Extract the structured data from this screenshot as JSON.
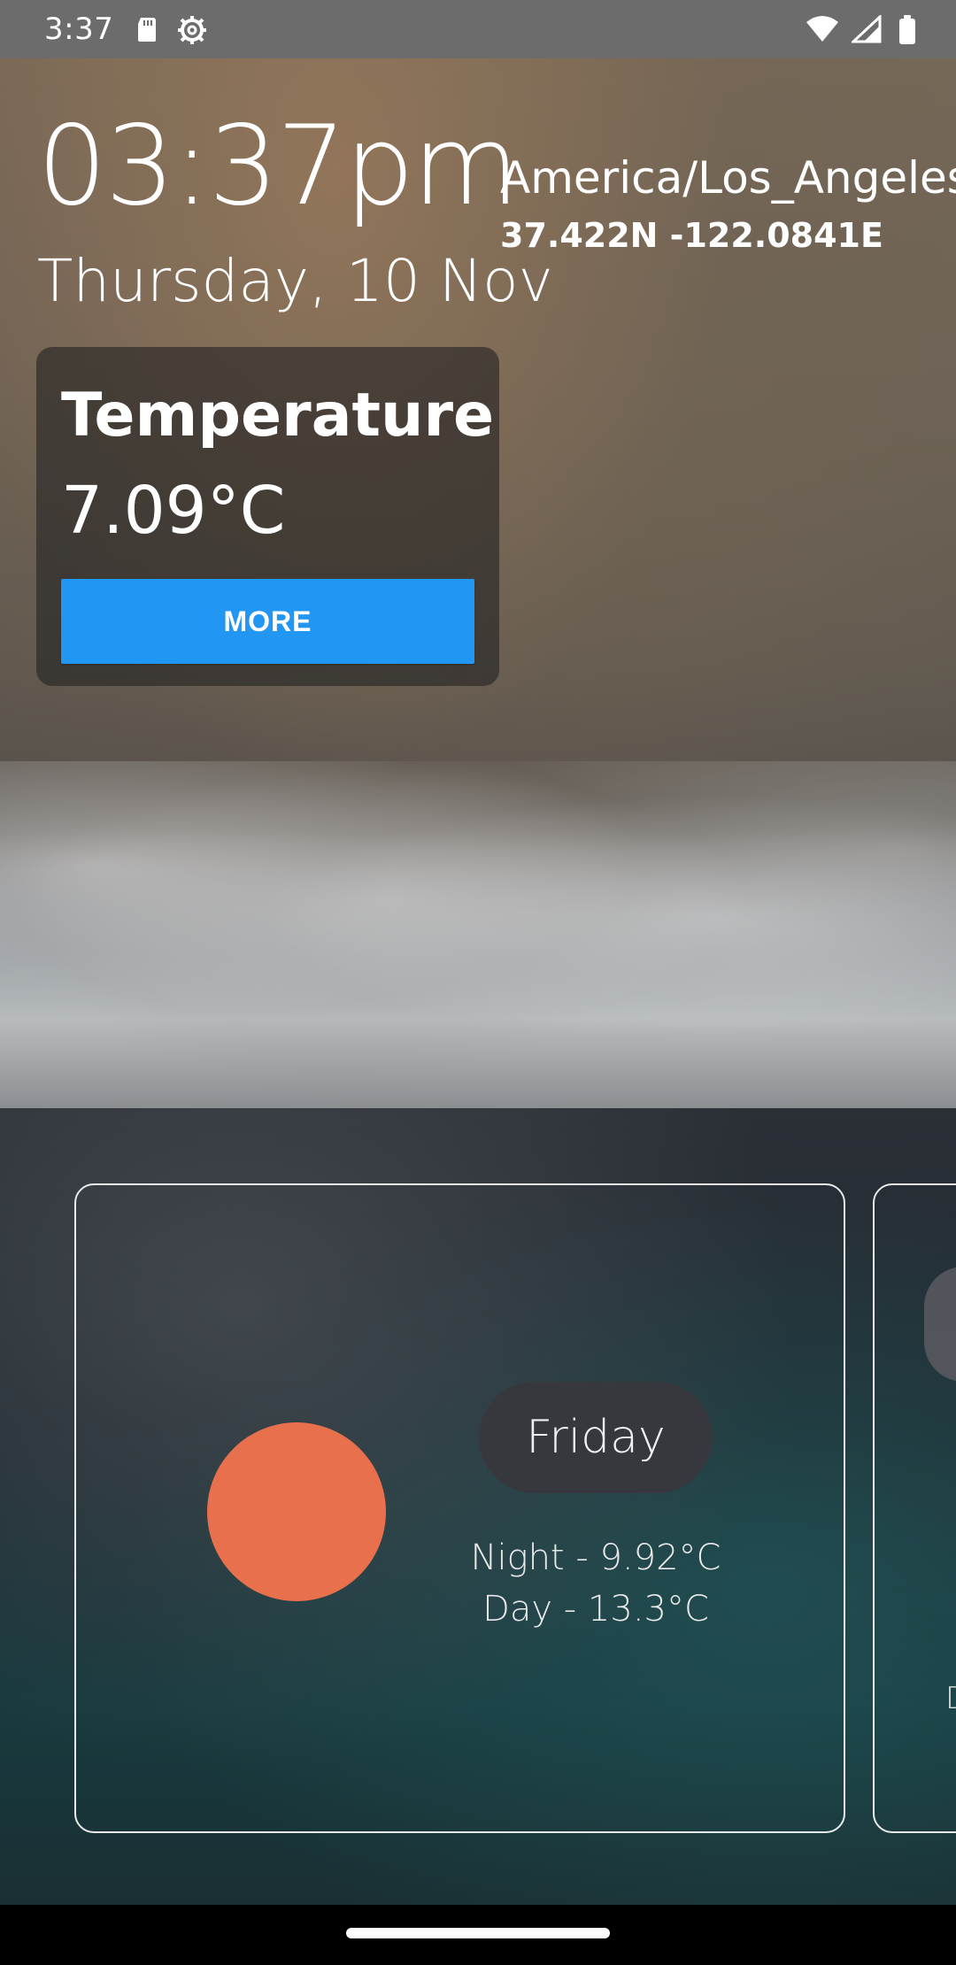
{
  "status_bar": {
    "time": "3:37"
  },
  "header": {
    "time": "03:37pm",
    "date": "Thursday, 10 Nov",
    "timezone": "America/Los_Angeles",
    "coords": "37.422N -122.0841E"
  },
  "temperature_card": {
    "title": "Temperature",
    "value": "7.09°C",
    "more_label": "MORE"
  },
  "forecast": {
    "cards": [
      {
        "day": "Friday",
        "night": "Night - 9.92°C",
        "day_temp": "Day - 13.3°C",
        "sun_color": "#e8704d"
      }
    ],
    "next_card_letter": "D"
  },
  "colors": {
    "accent": "#2196f3",
    "sun": "#e8704d"
  }
}
